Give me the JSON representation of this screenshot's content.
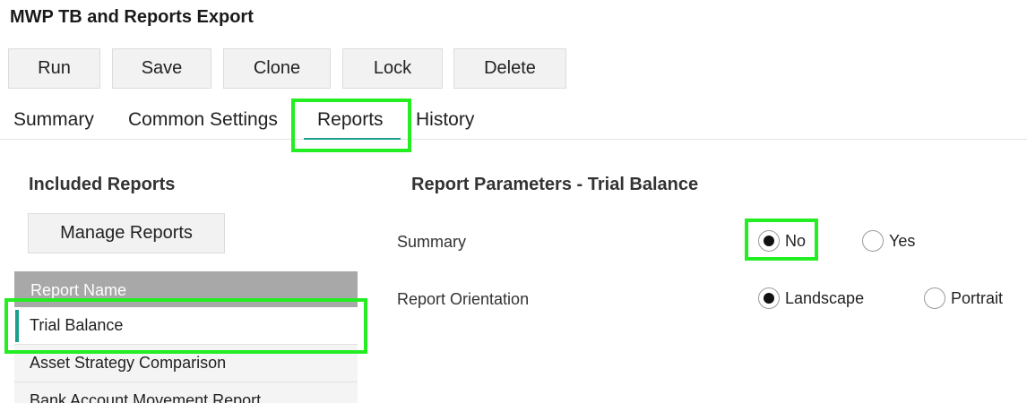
{
  "page": {
    "title": "MWP TB and Reports Export"
  },
  "toolbar": {
    "run": "Run",
    "save": "Save",
    "clone": "Clone",
    "lock": "Lock",
    "delete": "Delete"
  },
  "tabs": {
    "summary": "Summary",
    "common_settings": "Common Settings",
    "reports": "Reports",
    "history": "History",
    "active": "Reports"
  },
  "included_reports": {
    "title": "Included Reports",
    "manage_button": "Manage Reports",
    "column_header": "Report Name",
    "rows": [
      "Trial Balance",
      "Asset Strategy Comparison",
      "Bank Account Movement Report"
    ],
    "selected": "Trial Balance"
  },
  "report_parameters": {
    "title": "Report Parameters - Trial Balance",
    "summary": {
      "label": "Summary",
      "options": [
        "No",
        "Yes"
      ],
      "selected": "No"
    },
    "orientation": {
      "label": "Report Orientation",
      "options": [
        "Landscape",
        "Portrait"
      ],
      "selected": "Landscape"
    }
  },
  "colors": {
    "accent": "#1a9e8e",
    "highlight": "#22ee22",
    "header_bg": "#a8a8a8"
  }
}
